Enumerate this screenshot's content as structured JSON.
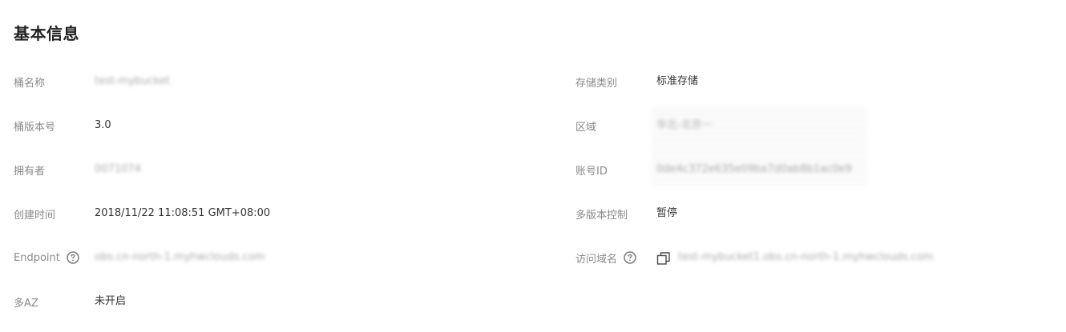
{
  "section_title": "基本信息",
  "left": {
    "bucket_name_label": "桶名称",
    "bucket_name_value": "test-mybucket",
    "bucket_version_label": "桶版本号",
    "bucket_version_value": "3.0",
    "owner_label": "拥有者",
    "owner_value": "0071074",
    "created_label": "创建时间",
    "created_value": "2018/11/22 11:08:51 GMT+08:00",
    "endpoint_label": "Endpoint",
    "endpoint_value": "obs.cn-north-1.myhwclouds.com",
    "multi_az_label": "多AZ",
    "multi_az_value": "未开启"
  },
  "right": {
    "storage_class_label": "存储类别",
    "storage_class_value": "标准存储",
    "region_label": "区域",
    "region_value": "华北-北京一",
    "account_id_label": "账号ID",
    "account_id_value": "0de4c372e635e09ba7d0ab8b1ac0e9",
    "versioning_label": "多版本控制",
    "versioning_value": "暂停",
    "domain_label": "访问域名",
    "domain_value": "test-mybucket1.obs.cn-north-1.myhwclouds.com"
  },
  "icons": {
    "help": "question-circle-icon",
    "copy": "copy-icon"
  },
  "colors": {
    "label": "#8a8a8a",
    "value": "#333333",
    "title": "#222222"
  }
}
